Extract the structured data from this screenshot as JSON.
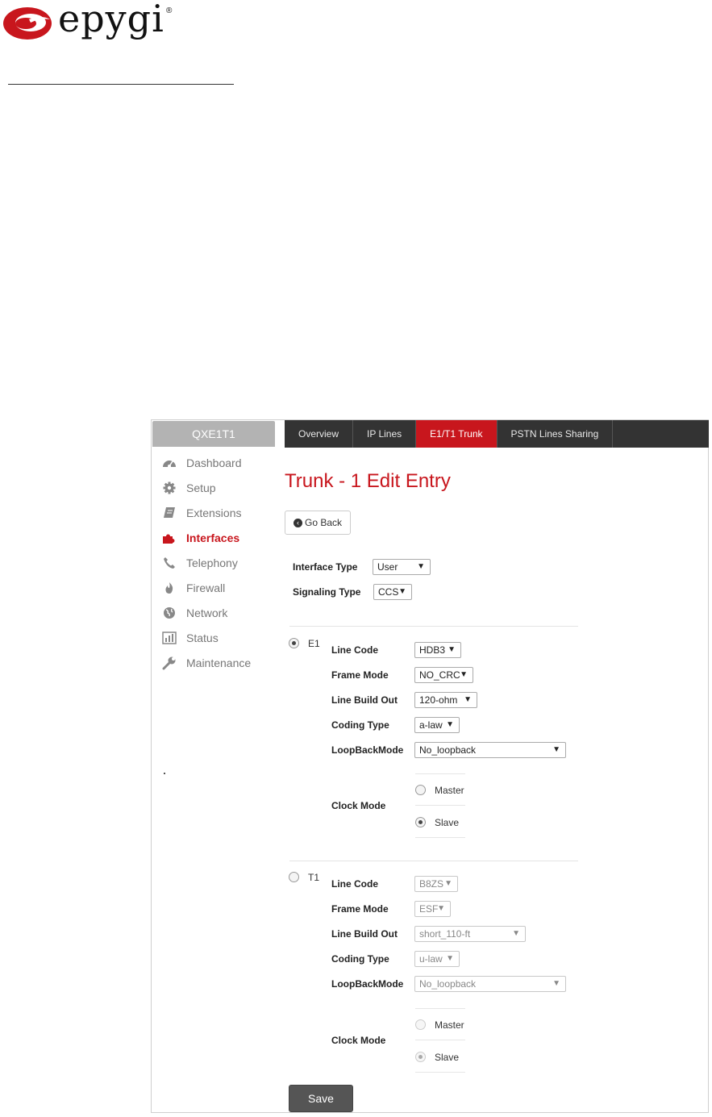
{
  "brand": {
    "name": "epygi",
    "reg_mark": "®",
    "accent": "#c8161d"
  },
  "sidebar": {
    "device": "QXE1T1",
    "items": [
      {
        "label": "Dashboard",
        "icon": "dashboard-icon"
      },
      {
        "label": "Setup",
        "icon": "gear-icon"
      },
      {
        "label": "Extensions",
        "icon": "book-icon"
      },
      {
        "label": "Interfaces",
        "icon": "puzzle-icon",
        "active": true
      },
      {
        "label": "Telephony",
        "icon": "phone-icon"
      },
      {
        "label": "Firewall",
        "icon": "fire-icon"
      },
      {
        "label": "Network",
        "icon": "globe-icon"
      },
      {
        "label": "Status",
        "icon": "bar-chart-icon"
      },
      {
        "label": "Maintenance",
        "icon": "wrench-icon"
      }
    ]
  },
  "tabs": [
    {
      "label": "Overview"
    },
    {
      "label": "IP Lines"
    },
    {
      "label": "E1/T1 Trunk",
      "active": true
    },
    {
      "label": "PSTN Lines Sharing"
    }
  ],
  "page": {
    "title": "Trunk - 1 Edit Entry",
    "go_back": "Go Back"
  },
  "interface_type": {
    "label": "Interface Type",
    "value": "User"
  },
  "signaling_type": {
    "label": "Signaling Type",
    "value": "CCS"
  },
  "e1": {
    "label": "E1",
    "selected": true,
    "line_code": {
      "label": "Line Code",
      "value": "HDB3"
    },
    "frame_mode": {
      "label": "Frame Mode",
      "value": "NO_CRC"
    },
    "line_build_out": {
      "label": "Line Build Out",
      "value": "120-ohm"
    },
    "coding_type": {
      "label": "Coding Type",
      "value": "a-law"
    },
    "loopback_mode": {
      "label": "LoopBackMode",
      "value": "No_loopback"
    },
    "clock_mode": {
      "label": "Clock Mode",
      "master": "Master",
      "slave": "Slave",
      "selected": "Slave"
    }
  },
  "t1": {
    "label": "T1",
    "selected": false,
    "line_code": {
      "label": "Line Code",
      "value": "B8ZS"
    },
    "frame_mode": {
      "label": "Frame Mode",
      "value": "ESF"
    },
    "line_build_out": {
      "label": "Line Build Out",
      "value": "short_110-ft"
    },
    "coding_type": {
      "label": "Coding Type",
      "value": "u-law"
    },
    "loopback_mode": {
      "label": "LoopBackMode",
      "value": "No_loopback"
    },
    "clock_mode": {
      "label": "Clock Mode",
      "master": "Master",
      "slave": "Slave",
      "selected": "Slave"
    }
  },
  "save_label": "Save"
}
